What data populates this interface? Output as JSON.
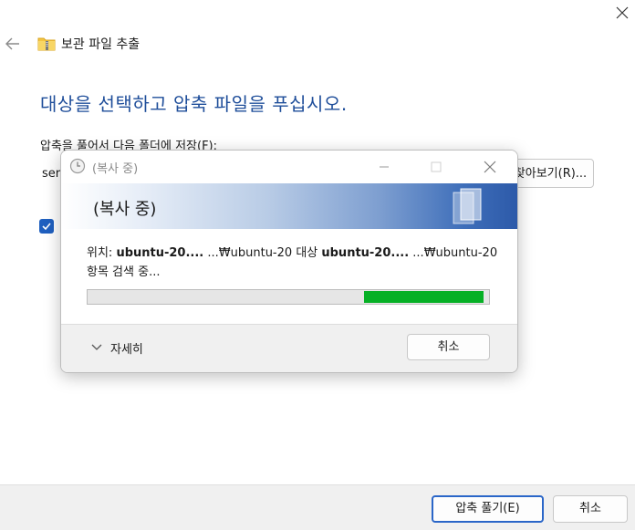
{
  "wizard": {
    "title": "보관 파일 추출",
    "heading": "대상을 선택하고 압축 파일을 푸십시오.",
    "extract_label": "압축을 풀어서 다음 폴더에 저장(F):",
    "path_value": "ser",
    "browse_label": "찾아보기(R)...",
    "checkbox_checked": true,
    "extract_button": "압축 풀기(E)",
    "cancel_button": "취소"
  },
  "copy_dialog": {
    "title": "(복사 중)",
    "banner_text": "(복사 중)",
    "location_prefix": "위치:",
    "location_from": "ubuntu-20....",
    "location_from_path": "...₩ubuntu-20",
    "target_prefix": "대상",
    "target_to": "ubuntu-20....",
    "target_to_path": "...₩ubuntu-20",
    "status": "항목 검색 중...",
    "progress_fraction": 0.3,
    "details_label": "자세히",
    "cancel_button": "취소"
  },
  "colors": {
    "accent": "#1f4e9a",
    "progress": "#06b025",
    "primary_border": "#2a66c8"
  },
  "icons": {
    "back": "back-arrow-icon",
    "folder": "zip-folder-icon",
    "close": "close-icon",
    "clock": "clock-icon",
    "minimize": "minimize-icon",
    "maximize": "maximize-icon",
    "chevron": "chevron-down-icon"
  }
}
